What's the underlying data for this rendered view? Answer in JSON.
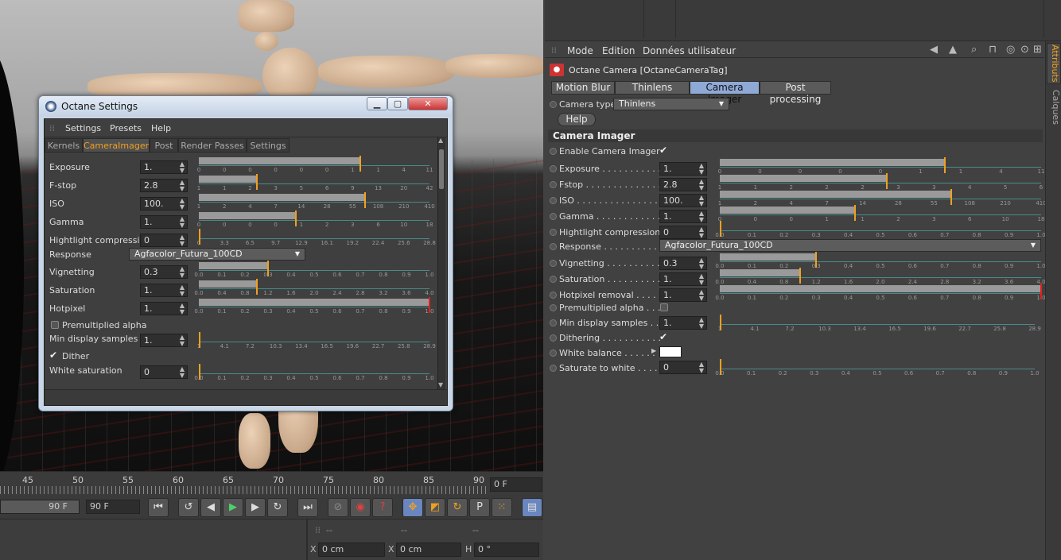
{
  "viewport": {},
  "timeline": {
    "ticks": [
      "45",
      "50",
      "55",
      "60",
      "65",
      "70",
      "75",
      "80",
      "85",
      "90"
    ],
    "current_frame": "0 F",
    "end_field_1": "90 F",
    "end_field_2": "90 F"
  },
  "coords": {
    "col_headers": [
      "--",
      "--",
      "--"
    ],
    "x_label": "X",
    "x_value": "0 cm",
    "x2_label": "X",
    "x2_value": "0 cm",
    "h_label": "H",
    "h_value": "0 °"
  },
  "attributes": {
    "menu": [
      "Mode",
      "Edition",
      "Données utilisateur"
    ],
    "object_title": "Octane Camera [OctaneCameraTag]",
    "tabs": [
      "Motion Blur",
      "Thinlens",
      "Camera Imager",
      "Post processing"
    ],
    "active_tab": "Camera Imager",
    "camera_type_label": "Camera type",
    "camera_type_value": "Thinlens",
    "help_label": "Help",
    "section_title": "Camera Imager",
    "enable_label": "Enable Camera Imager",
    "enable_checked": true,
    "params": [
      {
        "label": "Exposure . . . . . . . . . . . .",
        "value": "1.",
        "fill": 0.7,
        "ticks": [
          "0",
          "0",
          "0",
          "0",
          "0",
          "1",
          "1",
          "4",
          "11"
        ]
      },
      {
        "label": "Fstop . . . . . . . . . . . . . . .",
        "value": "2.8",
        "fill": 0.52,
        "ticks": [
          "1",
          "1",
          "2",
          "2",
          "2",
          "3",
          "3",
          "4",
          "5",
          "6"
        ]
      },
      {
        "label": "ISO . . . . . . . . . . . . . . . .",
        "value": "100.",
        "fill": 0.72,
        "ticks": [
          "1",
          "2",
          "4",
          "7",
          "14",
          "28",
          "55",
          "108",
          "210",
          "410"
        ]
      },
      {
        "label": "Gamma . . . . . . . . . . . . . .",
        "value": "1.",
        "fill": 0.42,
        "ticks": [
          "0",
          "0",
          "0",
          "1",
          "1",
          "2",
          "3",
          "6",
          "10",
          "18"
        ]
      },
      {
        "label": "Hightlight compression",
        "value": "0",
        "fill": 0,
        "ticks": [
          "0.0",
          "0.1",
          "0.2",
          "0.3",
          "0.4",
          "0.5",
          "0.6",
          "0.7",
          "0.8",
          "0.9",
          "1.0"
        ]
      }
    ],
    "response_label": "Response . . . . . . . . . .",
    "response_value": "Agfacolor_Futura_100CD",
    "params2": [
      {
        "label": "Vignetting . . . . . . . . . . .",
        "value": "0.3",
        "fill": 0.3,
        "ticks": [
          "0.0",
          "0.1",
          "0.2",
          "0.3",
          "0.4",
          "0.5",
          "0.6",
          "0.7",
          "0.8",
          "0.9",
          "1.0"
        ]
      },
      {
        "label": "Saturation . . . . . . . . . . .",
        "value": "1.",
        "fill": 0.25,
        "ticks": [
          "0.0",
          "0.4",
          "0.8",
          "1.2",
          "1.6",
          "2.0",
          "2.4",
          "2.8",
          "3.2",
          "3.6",
          "4.0"
        ]
      },
      {
        "label": "Hotpixel removal . . . . . . .",
        "value": "1.",
        "fill": 1.0,
        "ticks": [
          "0.0",
          "0.1",
          "0.2",
          "0.3",
          "0.4",
          "0.5",
          "0.6",
          "0.7",
          "0.8",
          "0.9",
          "1.0"
        ]
      }
    ],
    "premult_label": "Premultiplied alpha . . .",
    "min_display_label": "Min display samples . . .",
    "min_display_value": "1.",
    "min_display_ticks": [
      "1",
      "4.1",
      "7.2",
      "10.3",
      "13.4",
      "16.5",
      "19.6",
      "22.7",
      "25.8",
      "28.9"
    ],
    "dithering_label": "Dithering . . . . . . . . . . .",
    "white_balance_label": "White balance . . . . . .",
    "saturate_label": "Saturate to white . . . .",
    "saturate_value": "0",
    "saturate_ticks": [
      "0.0",
      "0.1",
      "0.2",
      "0.3",
      "0.4",
      "0.5",
      "0.6",
      "0.7",
      "0.8",
      "0.9",
      "1.0"
    ],
    "side_tabs": [
      "Attributs",
      "Calques"
    ]
  },
  "dialog": {
    "title": "Octane Settings",
    "menu": [
      "Settings",
      "Presets",
      "Help"
    ],
    "tabs": [
      "Kernels",
      "CameraImager",
      "Post",
      "Render Passes",
      "Settings"
    ],
    "active_tab": "CameraImager",
    "rows": [
      {
        "label": "Exposure",
        "value": "1.",
        "fill": 0.7,
        "ticks": [
          "0",
          "0",
          "0",
          "0",
          "0",
          "0",
          "1",
          "1",
          "4",
          "11"
        ]
      },
      {
        "label": "F-stop",
        "value": "2.8",
        "fill": 0.25,
        "ticks": [
          "1",
          "1",
          "2",
          "3",
          "5",
          "6",
          "9",
          "13",
          "20",
          "42"
        ]
      },
      {
        "label": "ISO",
        "value": "100.",
        "fill": 0.72,
        "ticks": [
          "1",
          "2",
          "4",
          "7",
          "14",
          "28",
          "55",
          "108",
          "210",
          "410"
        ]
      },
      {
        "label": "Gamma",
        "value": "1.",
        "fill": 0.42,
        "ticks": [
          "0",
          "0",
          "0",
          "0",
          "1",
          "2",
          "3",
          "6",
          "10",
          "18"
        ]
      },
      {
        "label": "Hightlight compressi",
        "value": "0",
        "fill": 0,
        "ticks": [
          "0",
          "3.3",
          "6.5",
          "9.7",
          "12.9",
          "16.1",
          "19.2",
          "22.4",
          "25.6",
          "28.8"
        ]
      }
    ],
    "response_label": "Response",
    "response_value": "Agfacolor_Futura_100CD",
    "rows2": [
      {
        "label": "Vignetting",
        "value": "0.3",
        "fill": 0.3,
        "ticks": [
          "0.0",
          "0.1",
          "0.2",
          "0.3",
          "0.4",
          "0.5",
          "0.6",
          "0.7",
          "0.8",
          "0.9",
          "1.0"
        ]
      },
      {
        "label": "Saturation",
        "value": "1.",
        "fill": 0.25,
        "ticks": [
          "0.0",
          "0.4",
          "0.8",
          "1.2",
          "1.6",
          "2.0",
          "2.4",
          "2.8",
          "3.2",
          "3.6",
          "4.0"
        ]
      },
      {
        "label": "Hotpixel",
        "value": "1.",
        "fill": 1.0,
        "ticks": [
          "0.0",
          "0.1",
          "0.2",
          "0.3",
          "0.4",
          "0.5",
          "0.6",
          "0.7",
          "0.8",
          "0.9",
          "1.0"
        ]
      }
    ],
    "premult_label": "Premultiplied alpha",
    "min_display_label": "Min display samples",
    "min_display_value": "1.",
    "min_display_ticks": [
      "1",
      "4.1",
      "7.2",
      "10.3",
      "13.4",
      "16.5",
      "19.6",
      "22.7",
      "25.8",
      "28.9"
    ],
    "dither_label": "Dither",
    "white_sat_label": "White saturation",
    "white_sat_value": "0",
    "white_sat_ticks": [
      "0.0",
      "0.1",
      "0.2",
      "0.3",
      "0.4",
      "0.5",
      "0.6",
      "0.7",
      "0.8",
      "0.9",
      "1.0"
    ]
  }
}
